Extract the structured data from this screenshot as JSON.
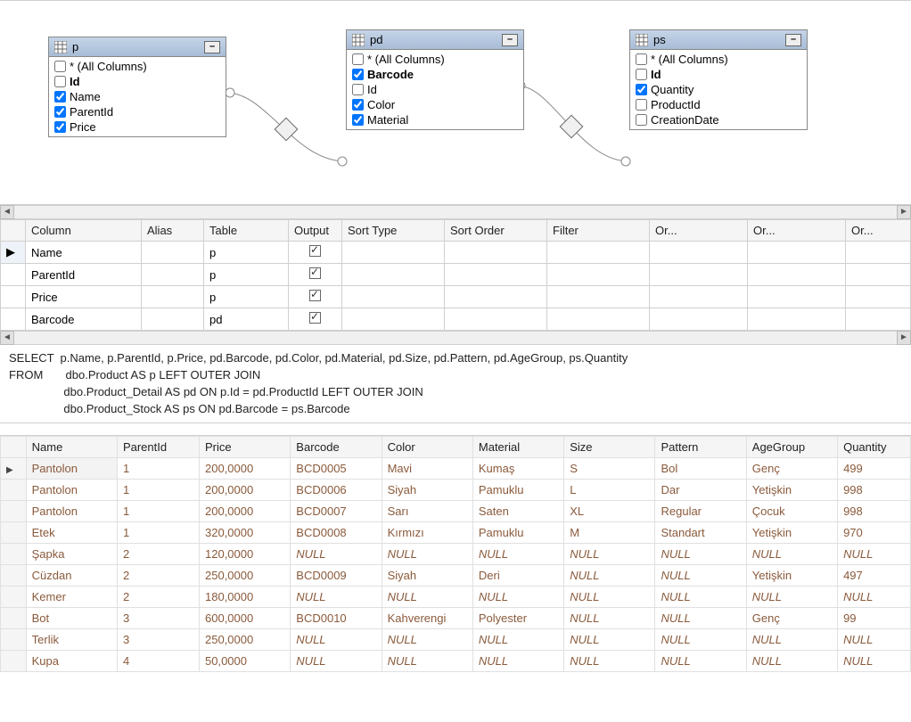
{
  "diagram": {
    "tables": [
      {
        "alias": "p",
        "cols": [
          {
            "name": "* (All Columns)",
            "checked": false,
            "bold": false
          },
          {
            "name": "Id",
            "checked": false,
            "bold": true
          },
          {
            "name": "Name",
            "checked": true,
            "bold": false
          },
          {
            "name": "ParentId",
            "checked": true,
            "bold": false
          },
          {
            "name": "Price",
            "checked": true,
            "bold": false
          }
        ]
      },
      {
        "alias": "pd",
        "cols": [
          {
            "name": "* (All Columns)",
            "checked": false,
            "bold": false
          },
          {
            "name": "Barcode",
            "checked": true,
            "bold": true
          },
          {
            "name": "Id",
            "checked": false,
            "bold": false
          },
          {
            "name": "Color",
            "checked": true,
            "bold": false
          },
          {
            "name": "Material",
            "checked": true,
            "bold": false
          }
        ]
      },
      {
        "alias": "ps",
        "cols": [
          {
            "name": "* (All Columns)",
            "checked": false,
            "bold": false
          },
          {
            "name": "Id",
            "checked": false,
            "bold": true
          },
          {
            "name": "Quantity",
            "checked": true,
            "bold": false
          },
          {
            "name": "ProductId",
            "checked": false,
            "bold": false
          },
          {
            "name": "CreationDate",
            "checked": false,
            "bold": false
          }
        ]
      }
    ]
  },
  "criteria": {
    "headers": [
      "Column",
      "Alias",
      "Table",
      "Output",
      "Sort Type",
      "Sort Order",
      "Filter",
      "Or...",
      "Or...",
      "Or..."
    ],
    "rows": [
      {
        "col": "Name",
        "alias": "",
        "table": "p",
        "output": true
      },
      {
        "col": "ParentId",
        "alias": "",
        "table": "p",
        "output": true
      },
      {
        "col": "Price",
        "alias": "",
        "table": "p",
        "output": true
      },
      {
        "col": "Barcode",
        "alias": "",
        "table": "pd",
        "output": true
      }
    ]
  },
  "sql": {
    "select": "SELECT  p.Name, p.ParentId, p.Price, pd.Barcode, pd.Color, pd.Material, pd.Size, pd.Pattern, pd.AgeGroup, ps.Quantity",
    "from": "FROM       dbo.Product AS p LEFT OUTER JOIN",
    "j1": "                 dbo.Product_Detail AS pd ON p.Id = pd.ProductId LEFT OUTER JOIN",
    "j2": "                 dbo.Product_Stock AS ps ON pd.Barcode = ps.Barcode"
  },
  "results": {
    "headers": [
      "Name",
      "ParentId",
      "Price",
      "Barcode",
      "Color",
      "Material",
      "Size",
      "Pattern",
      "AgeGroup",
      "Quantity"
    ],
    "rows": [
      [
        "Pantolon",
        "1",
        "200,0000",
        "BCD0005",
        "Mavi",
        "Kumaş",
        "S",
        "Bol",
        "Genç",
        "499"
      ],
      [
        "Pantolon",
        "1",
        "200,0000",
        "BCD0006",
        "Siyah",
        "Pamuklu",
        "L",
        "Dar",
        "Yetişkin",
        "998"
      ],
      [
        "Pantolon",
        "1",
        "200,0000",
        "BCD0007",
        "Sarı",
        "Saten",
        "XL",
        "Regular",
        "Çocuk",
        "998"
      ],
      [
        "Etek",
        "1",
        "320,0000",
        "BCD0008",
        "Kırmızı",
        "Pamuklu",
        "M",
        "Standart",
        "Yetişkin",
        "970"
      ],
      [
        "Şapka",
        "2",
        "120,0000",
        "NULL",
        "NULL",
        "NULL",
        "NULL",
        "NULL",
        "NULL",
        "NULL"
      ],
      [
        "Cüzdan",
        "2",
        "250,0000",
        "BCD0009",
        "Siyah",
        "Deri",
        "NULL",
        "NULL",
        "Yetişkin",
        "497"
      ],
      [
        "Kemer",
        "2",
        "180,0000",
        "NULL",
        "NULL",
        "NULL",
        "NULL",
        "NULL",
        "NULL",
        "NULL"
      ],
      [
        "Bot",
        "3",
        "600,0000",
        "BCD0010",
        "Kahverengi",
        "Polyester",
        "NULL",
        "NULL",
        "Genç",
        "99"
      ],
      [
        "Terlik",
        "3",
        "250,0000",
        "NULL",
        "NULL",
        "NULL",
        "NULL",
        "NULL",
        "NULL",
        "NULL"
      ],
      [
        "Kupa",
        "4",
        "50,0000",
        "NULL",
        "NULL",
        "NULL",
        "NULL",
        "NULL",
        "NULL",
        "NULL"
      ]
    ],
    "null_literal": "NULL"
  }
}
